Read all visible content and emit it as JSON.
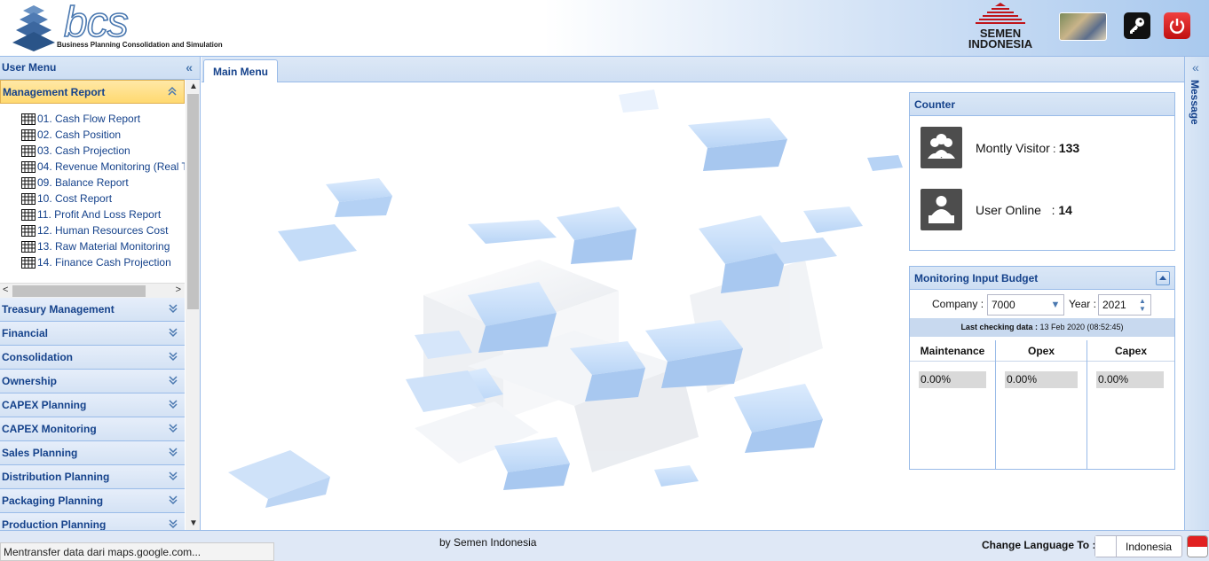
{
  "header": {
    "brand": "bcs",
    "tagline": "Business Planning Consolidation and Simulation",
    "company_logo_line1": "SEMEN",
    "company_logo_line2": "INDONESIA"
  },
  "sidebar": {
    "title": "User Menu",
    "active_section": "Management Report",
    "reports": [
      "01. Cash Flow Report",
      "02. Cash Position",
      "03. Cash Projection",
      "04. Revenue Monitoring (Real T",
      "09. Balance Report",
      "10. Cost Report",
      "11. Profit And Loss Report",
      "12. Human Resources Cost",
      "13. Raw Material Monitoring",
      "14. Finance Cash Projection"
    ],
    "sections": [
      "Treasury Management",
      "Financial",
      "Consolidation",
      "Ownership",
      "CAPEX Planning",
      "CAPEX Monitoring",
      "Sales Planning",
      "Distribution Planning",
      "Packaging Planning",
      "Production Planning"
    ]
  },
  "tabs": {
    "main": "Main Menu"
  },
  "counter": {
    "title": "Counter",
    "visitor_label": "Montly Visitor",
    "visitor_sep": " : ",
    "visitor_value": "133",
    "online_label": "User Online",
    "online_sep": "   : ",
    "online_value": "14"
  },
  "budget": {
    "title": "Monitoring Input Budget",
    "company_label": "Company :",
    "company_value": "7000",
    "year_label": "Year :",
    "year_value": "2021",
    "last_check_label": "Last checking data :",
    "last_check_value": " 13 Feb 2020 (08:52:45)",
    "columns": [
      {
        "name": "Maintenance",
        "value": "0.00%"
      },
      {
        "name": "Opex",
        "value": "0.00%"
      },
      {
        "name": "Capex",
        "value": "0.00%"
      }
    ]
  },
  "message_panel": {
    "title": "Message"
  },
  "footer": {
    "by": "by Semen Indonesia",
    "change_language": "Change Language To :",
    "language": "Indonesia"
  },
  "status_bar": "Mentransfer data dari maps.google.com...",
  "colors": {
    "accent": "#15428b",
    "border": "#99bbe8",
    "active_section": "#ffd970",
    "power": "#d42020"
  }
}
